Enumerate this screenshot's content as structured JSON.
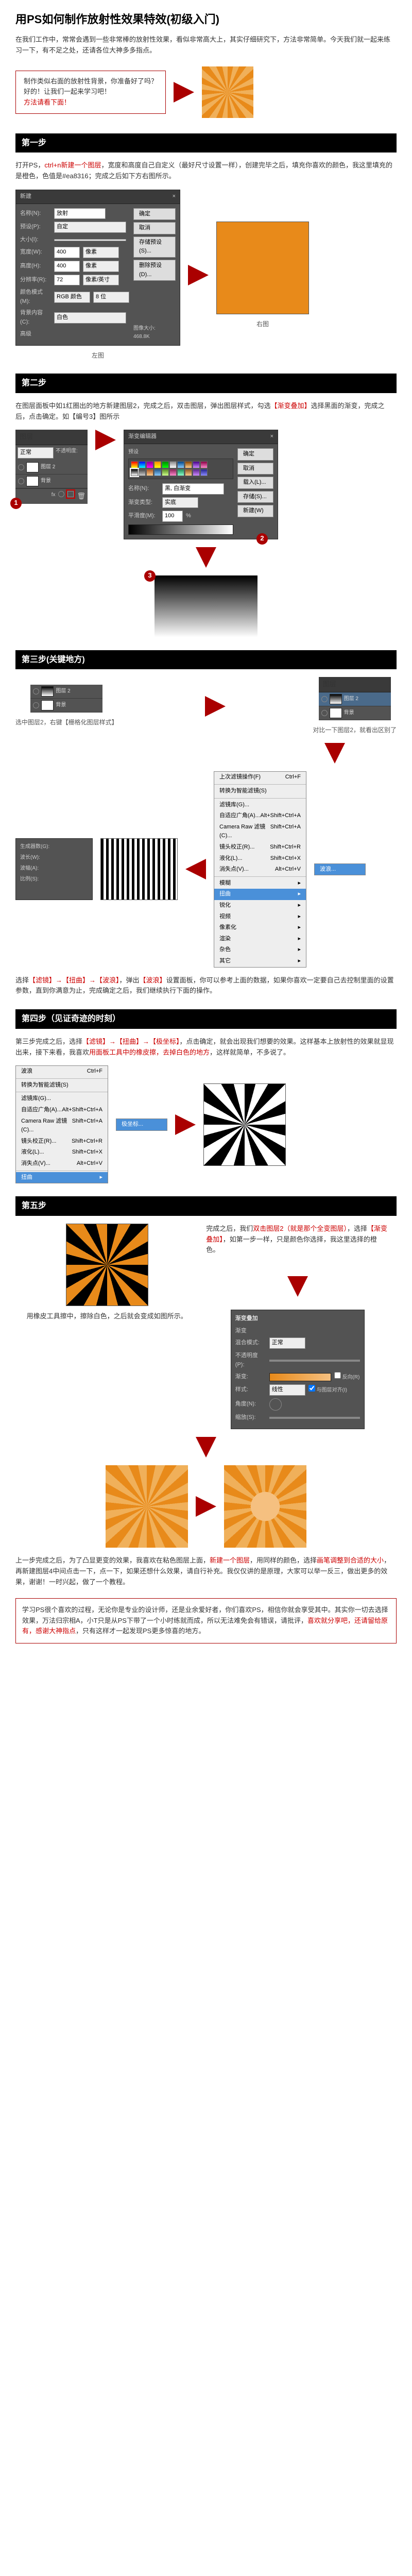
{
  "title": "用PS如何制作放射性效果特效(初级入门)",
  "intro": "在我们工作中，常常会遇到一些非常棒的放射性效果，看似非常高大上，其实仔细研究下，方法非常简单。今天我们就一起来练习一下，有不足之处，还请各位大神多多指点。",
  "promo": {
    "line1": "制作类似右面的放射性背景，你准备好了吗？",
    "line2": "好的！让我们一起来学习吧！",
    "line3": "方法请看下面！"
  },
  "step1": {
    "header": "第一步",
    "text_a": "打开PS，",
    "text_b": "ctrl+n新建一个图层",
    "text_c": "，宽度和高度自己自定义（最好尺寸设置一样），创建完毕之后，填充你喜欢的颜色，我这里填充的是橙色，色值是#ea8316；完成之后如下方右图所示。",
    "dialog": {
      "title": "新建",
      "name_lbl": "名称(N):",
      "name_val": "放射",
      "preset_lbl": "预设(P):",
      "preset_val": "自定",
      "size_lbl": "大小(I):",
      "width_lbl": "宽度(W):",
      "width_val": "400",
      "height_lbl": "高度(H):",
      "height_val": "400",
      "unit": "像素",
      "res_lbl": "分辨率(R):",
      "res_val": "72",
      "res_unit": "像素/英寸",
      "mode_lbl": "颜色模式(M):",
      "mode_val": "RGB 颜色",
      "bit": "8 位",
      "bg_lbl": "背景内容(C):",
      "bg_val": "白色",
      "adv": "高级",
      "size_info": "图像大小:",
      "size_bytes": "468.8K",
      "ok": "确定",
      "cancel": "取消",
      "save_preset": "存储预设(S)...",
      "del_preset": "删除预设(D)..."
    },
    "cap_left": "左图",
    "cap_right": "右图"
  },
  "step2": {
    "header": "第二步",
    "text_a": "在图层面板中如1红圈出的地方新建图层2，",
    "text_b": "完成之后，双击图层，弹出图层样式，勾选",
    "text_c": "【渐变叠加】",
    "text_d": "选择黑面的渐变，完成之后，点击确定。如【编号3】图所示",
    "layer_panel": {
      "tab": "图层",
      "layer2": "图层 2",
      "bg": "背景",
      "opacity": "不透明度:",
      "fill": "填充:",
      "normal": "正常"
    },
    "grad_dialog": {
      "title": "渐变编辑器",
      "presets": "预设",
      "name_lbl": "名称(N):",
      "name_val": "黑, 白渐变",
      "type_lbl": "渐变类型:",
      "type_val": "实底",
      "smooth_lbl": "平滑度(M):",
      "smooth_val": "100",
      "ok": "确定",
      "cancel": "取消",
      "load": "载入(L)...",
      "save": "存储(S)...",
      "new": "新建(W)"
    }
  },
  "step3": {
    "header": "第三步(关键地方)",
    "sel": "选中图层2，右键【栅格化图层样式】",
    "cap_compare": "对比一下图层2，就看出区别了",
    "menu": {
      "ls": "上次滤镜操作(F)",
      "ls_key": "Ctrl+F",
      "smart": "转换为智能滤镜(S)",
      "gallery": "滤镜库(G)...",
      "adaptive": "自适应广角(A)...",
      "adaptive_key": "Alt+Shift+Ctrl+A",
      "raw": "Camera Raw 滤镜(C)...",
      "raw_key": "Shift+Ctrl+A",
      "lens": "镜头校正(R)...",
      "lens_key": "Shift+Ctrl+R",
      "liquify": "液化(L)...",
      "liquify_key": "Shift+Ctrl+X",
      "vanish": "消失点(V)...",
      "vanish_key": "Alt+Ctrl+V",
      "blur": "模糊",
      "distort": "扭曲",
      "sharpen": "锐化",
      "video": "视频",
      "pixelate": "像素化",
      "render": "渲染",
      "noise": "杂色",
      "other": "其它",
      "wave": "波浪..."
    },
    "desc_a": "选择",
    "desc_b": "【滤镜】→【扭曲】→【波浪】",
    "desc_c": "，弹出",
    "desc_d": "【波浪】",
    "desc_e": "设置面板，你可以参考上面的数据，如果你喜欢一定要自己去控制里面的设置参数，直到你满意为止，完成确定之后，我们继续执行下面的操作。"
  },
  "step4": {
    "header": "第四步（见证奇迹的时刻）",
    "text_a": "第三步完成之后，选择",
    "text_b": "【滤镜】→【扭曲】→【极坐标】",
    "text_c": "，点击确定，就会出现我们想要的效果。这样基本上放射性的效果就显现出来，接下来看，我喜欢",
    "text_d": "用面板工具中的橡皮擦，去掉白色的地方",
    "text_e": "，这样就简单，不多说了。",
    "menu": {
      "ls": "波浪",
      "ls_key": "Ctrl+F",
      "smart": "转换为智能滤镜(S)",
      "gallery": "滤镜库(G)...",
      "adaptive": "自适应广角(A)...",
      "adaptive_key": "Alt+Shift+Ctrl+A",
      "raw": "Camera Raw 滤镜(C)...",
      "raw_key": "Shift+Ctrl+A",
      "lens": "镜头校正(R)...",
      "lens_key": "Shift+Ctrl+R",
      "liquify": "液化(L)...",
      "liquify_key": "Shift+Ctrl+X",
      "vanish": "消失点(V)...",
      "vanish_key": "Alt+Ctrl+V",
      "distort": "扭曲",
      "polar": "极坐标..."
    }
  },
  "step5": {
    "header": "第五步",
    "left_text": "用橡皮工具擦中，擦除白色，之后就会变成如图所示。",
    "right_text_a": "完成之后，我们",
    "right_text_b": "双击图层2（就是那个全变图层）",
    "right_text_c": "，选择",
    "right_text_d": "【渐变叠加】",
    "right_text_e": "，如第一步一样，只是颜色你选择，我这里选择的橙色。",
    "grad_title": "渐变叠加",
    "grad_sub": "渐变",
    "blend_lbl": "混合模式:",
    "blend_val": "正常",
    "opacity_lbl": "不透明度(P):",
    "grad_lbl": "渐变:",
    "reverse": "反向(R)",
    "style_lbl": "样式:",
    "style_val": "线性",
    "align": "与图层对齐(I)",
    "angle_lbl": "角度(N):",
    "scale_lbl": "缩放(S):",
    "final_a": "上一步完成之后，为了凸显更变的效果，我喜欢在粘色图层上面，",
    "final_b": "新建一个图层",
    "final_c": "，用同样的颜色，选择",
    "final_d": "画笔调整到合适的大小",
    "final_e": "，再新建图层4中间点击一下，点一下，如果还想什么效果，请自行补充。",
    "final_f": "我仅仅讲的是原理，大家可以举一反三，做出更多的效果，谢谢！一时兴起，做了一个教程。"
  },
  "footer": {
    "a": "学习PS很个喜欢的过程，无论你是专业的设计师，还是业余爱好者，你们喜欢PS，相信你就会享受其中。其实你一切去选择效果，万法归宗相A，小T只是从PS下带了一个小时练就而成，所以无法难免会有错误，请批评，",
    "b": "喜欢就分享吧，还请留给原有，感谢大神指点",
    "c": "，只有这样才一起发现PS更多惊喜的地方。"
  }
}
